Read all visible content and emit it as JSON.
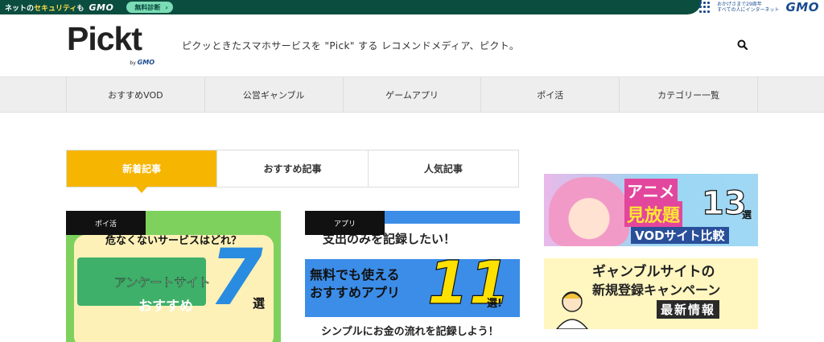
{
  "gmo_bar": {
    "left_text_1": "ネットの",
    "left_text_2": "セキュリティ",
    "left_text_3": "も",
    "left_logo": "GMO",
    "pill_label": "無料診断",
    "pill_arrow": "›",
    "right_small_1": "おかげさまで29周年",
    "right_small_2": "すべての人にインターネット",
    "right_logo": "GMO",
    "colors": {
      "bar": "#0b4d3f",
      "pill": "#7bdcb5",
      "gmo_blue": "#1a4b8f"
    }
  },
  "header": {
    "logo_word": "Pickt",
    "logo_by": "by",
    "logo_by_brand": "GMO",
    "tagline": "ピクッときたスマホサービスを \"Pick\" する レコメンドメディア、ピクト。",
    "search_icon": "search-icon"
  },
  "nav": {
    "items": [
      {
        "label": "おすすめVOD"
      },
      {
        "label": "公営ギャンブル"
      },
      {
        "label": "ゲームアプリ"
      },
      {
        "label": "ポイ活"
      },
      {
        "label": "カテゴリー一覧"
      }
    ]
  },
  "tabs": {
    "items": [
      {
        "label": "新着記事",
        "active": true
      },
      {
        "label": "おすすめ記事",
        "active": false
      },
      {
        "label": "人気記事",
        "active": false
      }
    ],
    "active_color": "#f6b500"
  },
  "cards": [
    {
      "category": "ポイ活",
      "question": "危なくないサービスはどれ？",
      "title_1": "アンケートサイト",
      "title_2": "おすすめ",
      "number": "7",
      "suffix": "選"
    },
    {
      "category": "アプリ",
      "top_text": "支出のみを記録したい！",
      "line_1": "無料でも使える",
      "line_2": "おすすめアプリ",
      "number": "11",
      "suffix": "選!",
      "bottom_text": "シンプルにお金の流れを記録しよう！"
    }
  ],
  "sidebar": {
    "banners": [
      {
        "line_1": "アニメ",
        "line_2": "見放題",
        "number": "13",
        "suffix": "選",
        "line_3": "VODサイト比較"
      },
      {
        "line_1": "ギャンブルサイトの",
        "line_2": "新規登録キャンペーン",
        "line_3": "最新情報"
      }
    ]
  }
}
